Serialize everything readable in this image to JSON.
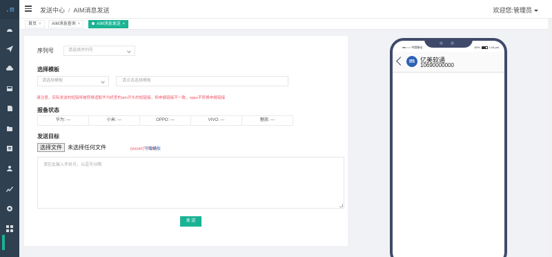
{
  "sidebar": {
    "logo": ".m",
    "icons": [
      "dashboard-icon",
      "send-icon",
      "cloud-icon",
      "inbox-icon",
      "document-icon",
      "folder-icon",
      "report-icon",
      "users-icon",
      "chart-icon",
      "settings-icon",
      "grid-icon"
    ]
  },
  "header": {
    "breadcrumb_root": "发送中心",
    "breadcrumb_sep": "/",
    "breadcrumb_current": "AIM消息发送",
    "user_greeting": "欢迎您:管理员"
  },
  "tabs": [
    {
      "label": "首页",
      "close": "×"
    },
    {
      "label": "AIM消息查询",
      "close": "×"
    },
    {
      "label": "AIM消息发送",
      "close": "×",
      "active": true
    }
  ],
  "form": {
    "serial_label": "序列号",
    "serial_placeholder": "请选择序列号",
    "template_section": "选择模板",
    "template_select_placeholder": "请选择模板",
    "template_input_placeholder": "请点击选择模板",
    "notice": "请注意，实际发送的短链将被转换适配华为机型的aim开头的短链接，和申报链接不一致，oppo不转换申报链接",
    "status_section": "报备状态",
    "status_items": [
      {
        "label": "华为:",
        "value": "---"
      },
      {
        "label": "小米:",
        "value": "---"
      },
      {
        "label": "OPPO:",
        "value": "---"
      },
      {
        "label": "VIVO:",
        "value": "---"
      },
      {
        "label": "魅族:",
        "value": "---"
      }
    ],
    "target_section": "发送目标",
    "file_button": "选择文件",
    "file_status": "未选择任何文件",
    "file_hint": "(excel小于5M)",
    "download_link": "下载模板",
    "phones_placeholder": "请在此输入手机号，以逗号分隔",
    "send_button": "发 送"
  },
  "phone": {
    "carrier": "●●○○○ 中国移动 ",
    "battery": "80%",
    "time": "1:43 pm",
    "sender_avatar": "m",
    "sender_name": "亿美软通",
    "sender_number": "10690000000"
  },
  "colors": {
    "sidebar_bg": "#2f4050",
    "accent": "#1ab394",
    "warning": "#ed5565",
    "link": "#337ab7",
    "phone_frame": "#3f4a6a"
  }
}
